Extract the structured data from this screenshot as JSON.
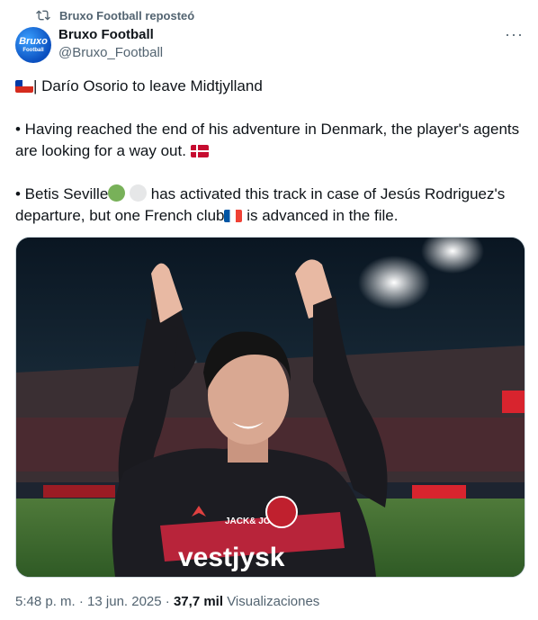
{
  "repost": {
    "icon": "repost-icon",
    "text": "Bruxo Football reposteó"
  },
  "author": {
    "avatar_line1": "Bruxo",
    "avatar_line2": "Football",
    "display_name": "Bruxo Football",
    "handle": "@Bruxo_Football"
  },
  "more_label": "···",
  "tweet": {
    "line1": "| Darío Osorio to leave Midtjylland",
    "line2": "• Having reached the end of his adventure in Denmark, the player's agents are looking for a way out.",
    "line3a": "• Betis Seville",
    "line3b": "has activated this track in case of Jesús Rodriguez's departure, but one French club",
    "line3c": "is advanced in the file."
  },
  "media": {
    "sponsor_text": "vestjysk",
    "sponsor_small": "JACK& JONES"
  },
  "meta": {
    "time": "5:48 p. m.",
    "sep": " · ",
    "date": "13 jun. 2025",
    "sep2": " · ",
    "views": "37,7 mil",
    "views_label": "Visualizaciones"
  },
  "colors": {
    "text": "#0f1419",
    "muted": "#536471",
    "border": "#cfd9de"
  }
}
